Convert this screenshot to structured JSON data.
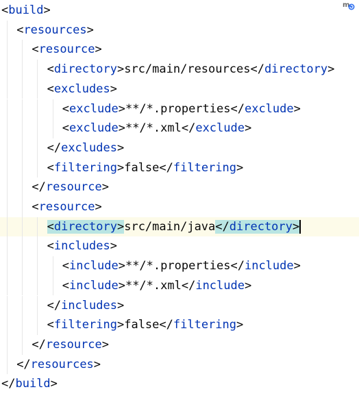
{
  "editor": {
    "lines": [
      {
        "indent": 0,
        "kind": "open",
        "tag": "build"
      },
      {
        "indent": 1,
        "kind": "open",
        "tag": "resources"
      },
      {
        "indent": 2,
        "kind": "open",
        "tag": "resource"
      },
      {
        "indent": 3,
        "kind": "elem",
        "tag": "directory",
        "value": "src/main/resources"
      },
      {
        "indent": 3,
        "kind": "open",
        "tag": "excludes"
      },
      {
        "indent": 4,
        "kind": "elem",
        "tag": "exclude",
        "value": "**/*.properties"
      },
      {
        "indent": 4,
        "kind": "elem",
        "tag": "exclude",
        "value": "**/*.xml"
      },
      {
        "indent": 3,
        "kind": "close",
        "tag": "excludes"
      },
      {
        "indent": 3,
        "kind": "elem",
        "tag": "filtering",
        "value": "false"
      },
      {
        "indent": 2,
        "kind": "close",
        "tag": "resource"
      },
      {
        "indent": 2,
        "kind": "open",
        "tag": "resource"
      },
      {
        "indent": 3,
        "kind": "elem",
        "tag": "directory",
        "value": "src/main/java",
        "current": true
      },
      {
        "indent": 3,
        "kind": "open",
        "tag": "includes"
      },
      {
        "indent": 4,
        "kind": "elem",
        "tag": "include",
        "value": "**/*.properties"
      },
      {
        "indent": 4,
        "kind": "elem",
        "tag": "include",
        "value": "**/*.xml"
      },
      {
        "indent": 3,
        "kind": "close",
        "tag": "includes"
      },
      {
        "indent": 3,
        "kind": "elem",
        "tag": "filtering",
        "value": "false"
      },
      {
        "indent": 2,
        "kind": "close",
        "tag": "resource"
      },
      {
        "indent": 1,
        "kind": "close",
        "tag": "resources"
      },
      {
        "indent": 0,
        "kind": "close",
        "tag": "build"
      }
    ],
    "colors": {
      "tag": "#0033b3",
      "bracket": "#080808",
      "text": "#080808",
      "current_line": "#fdfbe9",
      "matched_tag": "#b9e5e2"
    },
    "badge_icon": "maven-reload-icon"
  }
}
